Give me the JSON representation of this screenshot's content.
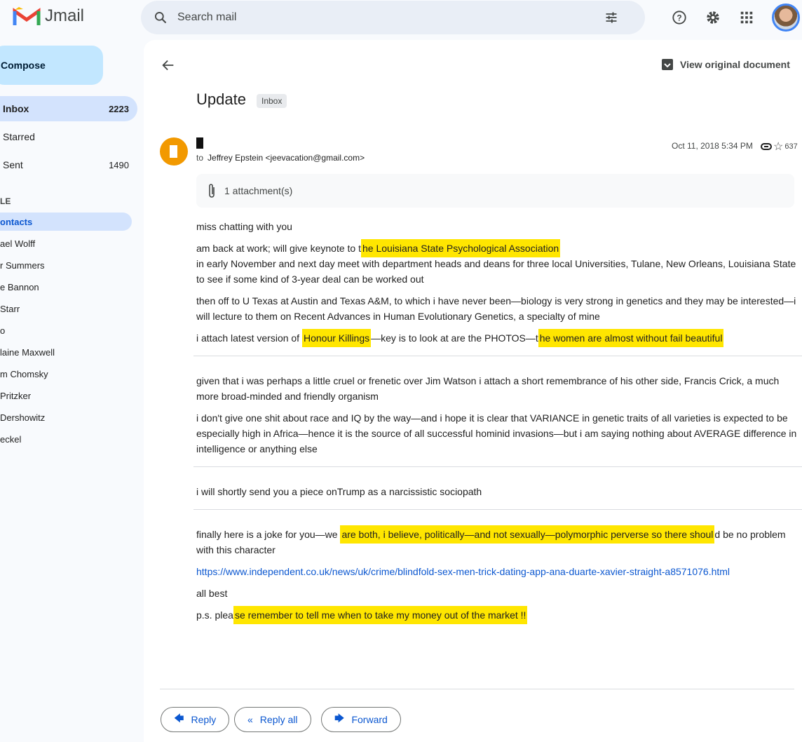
{
  "app": {
    "name": "Jmail"
  },
  "search": {
    "placeholder": "Search mail"
  },
  "sidebar": {
    "compose": "Compose",
    "items": [
      {
        "label": "Inbox",
        "count": "2223"
      },
      {
        "label": "Starred",
        "count": ""
      },
      {
        "label": "Sent",
        "count": "1490"
      }
    ],
    "section_label": "LE",
    "contacts": [
      "ontacts",
      "ael Wolff",
      "r Summers",
      "e Bannon",
      "Starr",
      "o",
      "laine Maxwell",
      "m Chomsky",
      "Pritzker",
      "Dershowitz",
      "eckel"
    ]
  },
  "toolbar": {
    "view_original": "View original document"
  },
  "email": {
    "subject": "Update",
    "label": "Inbox",
    "to_prefix": "to",
    "to": "Jeffrey Epstein <jeevacation@gmail.com>",
    "date": "Oct 11, 2018 5:34 PM",
    "count": "637",
    "attachments": "1 attachment(s)",
    "sections": [
      [
        [
          {
            "t": "miss chatting with you"
          }
        ],
        [
          {
            "t": "am back at work; will give keynote to t"
          },
          {
            "t": "he Louisiana State Psychological Association",
            "hl": true
          },
          {
            "br": true
          },
          {
            "t": "in early November and next day meet with department heads and deans for three local Universities, Tulane, New Orleans, Louisiana State to see if some kind of 3-year deal can be worked out"
          }
        ],
        [
          {
            "t": "then off to U Texas at Austin and Texas A&M, to which i have never been—biology is very strong in genetics and they may be interested—i will lecture to them on Recent Advances in Human Evolutionary Genetics, a specialty of mine"
          }
        ],
        [
          {
            "t": "i attach latest version of "
          },
          {
            "t": "Honour Killings",
            "hl": true
          },
          {
            "t": "—key is to look at are the PHOTOS—t"
          },
          {
            "t": "he women are almost without fail beautiful",
            "hl": true
          }
        ]
      ],
      [
        [
          {
            "t": "given that i was perhaps a little cruel or frenetic over Jim Watson i attach a short remembrance of his other side, Francis Crick, a much more broad-minded and friendly organism"
          }
        ],
        [
          {
            "t": "i don't give one shit about race and IQ by the way—and i hope it is clear that VARIANCE in genetic traits of all varieties is expected to be especially high in Africa—hence it is the source of all successful hominid invasions—but i am saying nothing about AVERAGE difference in intelligence or anything else"
          }
        ]
      ],
      [
        [
          {
            "t": "i will shortly send you a piece onTrump as a narcissistic sociopath"
          }
        ]
      ],
      [
        [
          {
            "t": "finally here is a joke for you—we "
          },
          {
            "t": "are both, i believe, politically—and not sexually—polymorphic perverse so there shoul",
            "hl": true
          },
          {
            "t": "d be no problem with this character"
          }
        ],
        [
          {
            "t": "https://www.independent.co.uk/news/uk/crime/blindfold-sex-men-trick-dating-app-ana-duarte-xavier-straight-a8571076.html",
            "link": true
          }
        ],
        [
          {
            "t": "all best"
          }
        ],
        [
          {
            "t": "p.s. plea"
          },
          {
            "t": "se remember to tell me when to take my money out of the market !!",
            "hl": true
          }
        ]
      ]
    ]
  },
  "actions": {
    "reply": "Reply",
    "reply_all": "Reply all",
    "forward": "Forward"
  },
  "colors": {
    "highlight": "#ffe600",
    "accent": "#0b57d0"
  }
}
